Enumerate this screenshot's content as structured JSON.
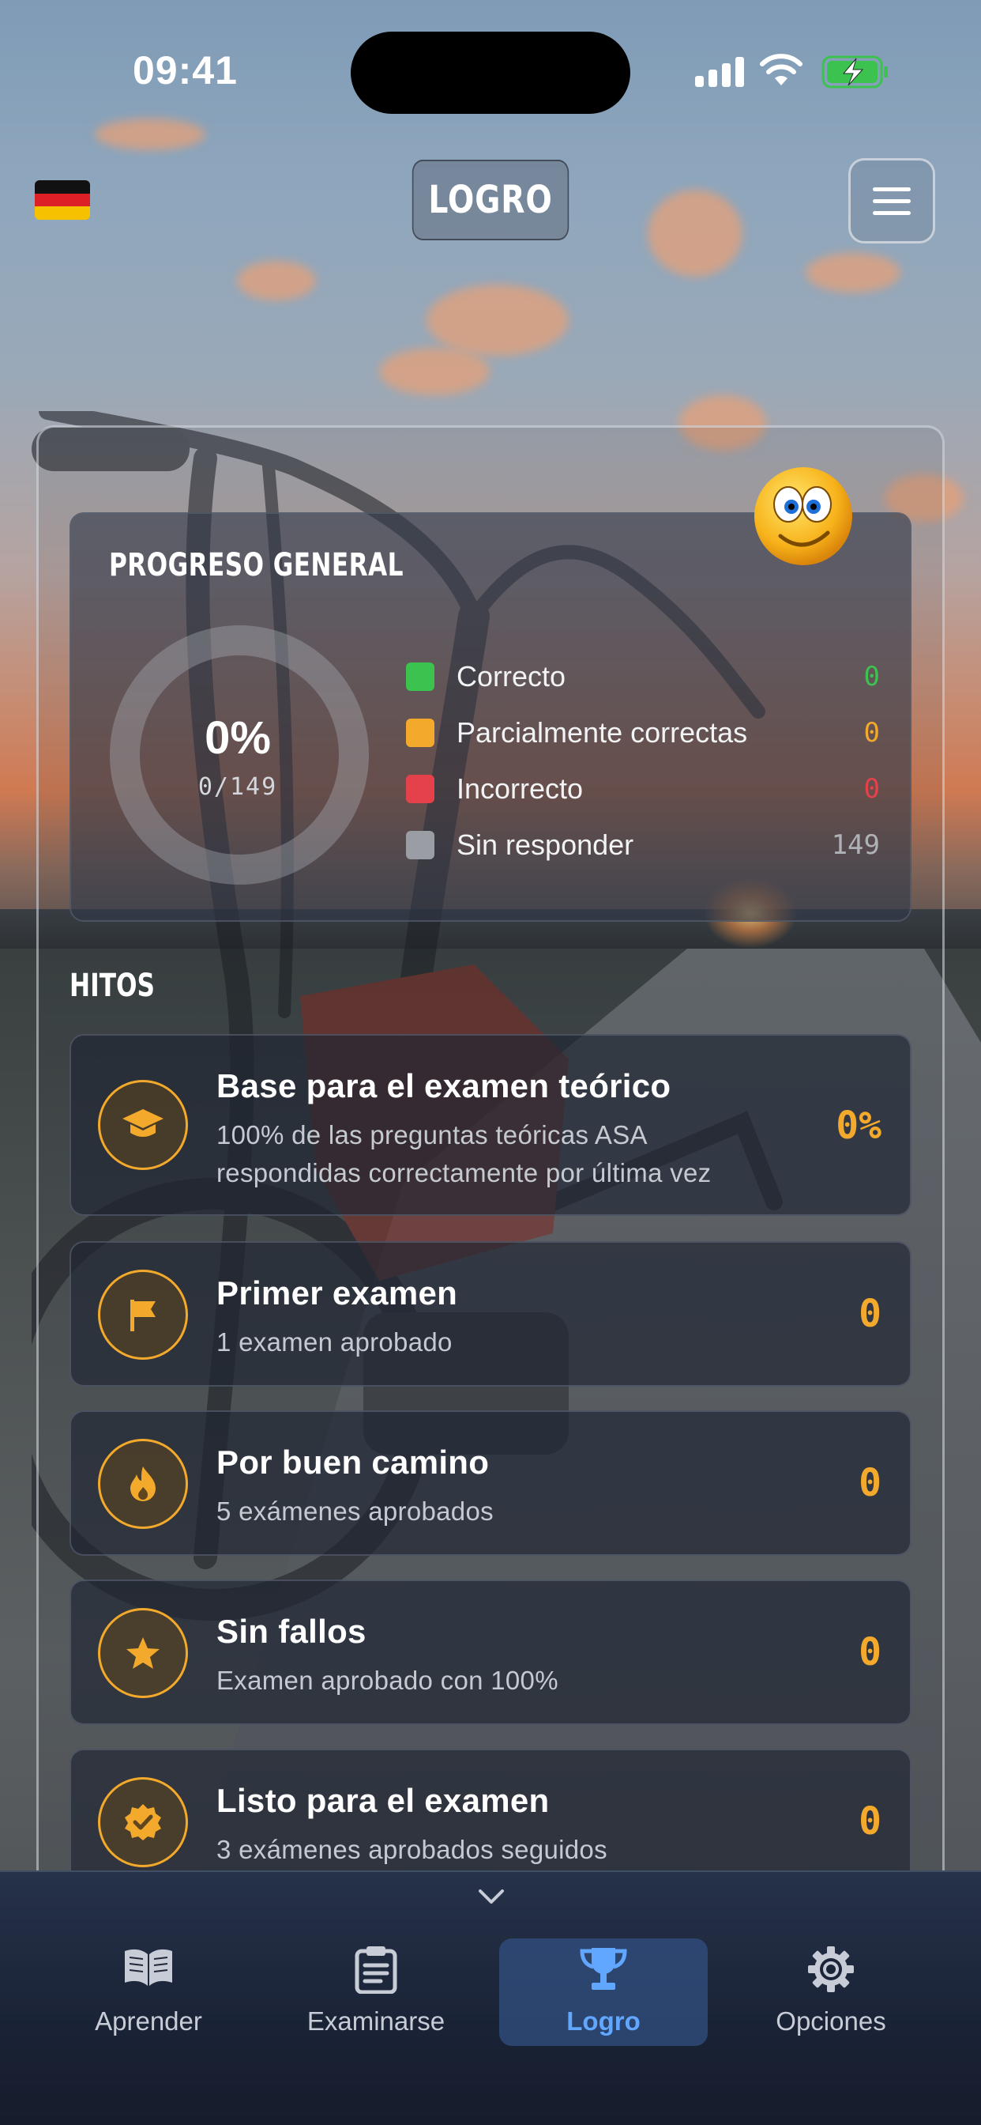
{
  "status_bar": {
    "time": "09:41"
  },
  "header": {
    "title": "LOGRO",
    "language_flag": "de-flag-icon",
    "menu_icon": "hamburger-menu-icon"
  },
  "overall_progress": {
    "title": "PROGRESO GENERAL",
    "percent_label": "0%",
    "count_label": "0/149",
    "answered": 0,
    "total": 149,
    "legend": [
      {
        "label": "Correcto",
        "value": "0",
        "color": "#3cc24f"
      },
      {
        "label": "Parcialmente correctas",
        "value": "0",
        "color": "#f3a92b"
      },
      {
        "label": "Incorrecto",
        "value": "0",
        "color": "#e5414b"
      },
      {
        "label": "Sin responder",
        "value": "149",
        "color": "#9a9da3"
      }
    ]
  },
  "milestones": {
    "title": "HITOS",
    "items": [
      {
        "title": "Base para el examen teórico",
        "desc_line1": "100% de las preguntas teóricas ASA",
        "desc_line2": "respondidas correctamente por última vez",
        "value": "0%",
        "icon": "graduation-cap-icon"
      },
      {
        "title": "Primer examen",
        "desc_line1": "1 examen aprobado",
        "value": "0",
        "icon": "flag-icon"
      },
      {
        "title": "Por buen camino",
        "desc_line1": "5 exámenes aprobados",
        "value": "0",
        "icon": "fire-icon"
      },
      {
        "title": "Sin fallos",
        "desc_line1": "Examen aprobado con 100%",
        "value": "0",
        "icon": "star-icon"
      },
      {
        "title": "Listo para el examen",
        "desc_line1": "3 exámenes aprobados seguidos",
        "value": "0",
        "icon": "badge-check-icon"
      }
    ]
  },
  "tabbar": {
    "tabs": [
      {
        "label": "Aprender",
        "icon": "book-icon",
        "active": false
      },
      {
        "label": "Examinarse",
        "icon": "clipboard-icon",
        "active": false
      },
      {
        "label": "Logro",
        "icon": "trophy-icon",
        "active": true
      },
      {
        "label": "Opciones",
        "icon": "gear-icon",
        "active": false
      }
    ]
  },
  "colors": {
    "accent": "#f3a92b",
    "active_tab": "#61a7ff"
  }
}
